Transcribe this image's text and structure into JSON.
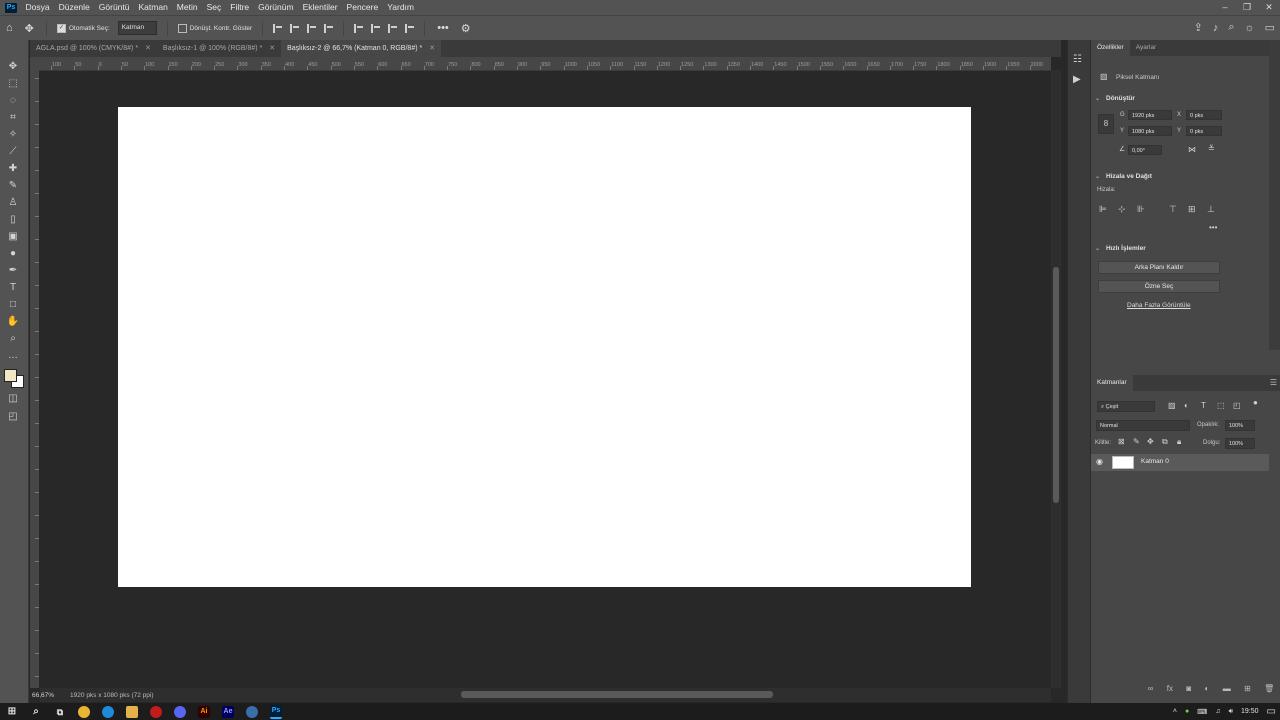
{
  "app": {
    "logo": "Ps"
  },
  "menu": [
    "Dosya",
    "Düzenle",
    "Görüntü",
    "Katman",
    "Metin",
    "Seç",
    "Filtre",
    "Görünüm",
    "Eklentiler",
    "Pencere",
    "Yardım"
  ],
  "window_controls": {
    "minimize": "–",
    "maximize": "❐",
    "close": "✕"
  },
  "options_bar": {
    "auto_select_label": "Otomatik Seç:",
    "auto_select_value": "Katman",
    "transform_label": "Dönüşt. Kontr. Göster",
    "more": "•••"
  },
  "tabs": [
    {
      "label": "AGLA.psd @ 100% (CMYK/8#) *",
      "active": false
    },
    {
      "label": "Başlıksız-1 @ 100% (RGB/8#) *",
      "active": false
    },
    {
      "label": "Başlıksız-2 @ 66,7% (Katman 0, RGB/8#) *",
      "active": true
    }
  ],
  "ruler_ticks": [
    "100",
    "50",
    "0",
    "50",
    "100",
    "150",
    "200",
    "250",
    "300",
    "350",
    "400",
    "450",
    "500",
    "550",
    "600",
    "650",
    "700",
    "750",
    "800",
    "850",
    "900",
    "950",
    "1000",
    "1050",
    "1100",
    "1150",
    "1200",
    "1250",
    "1300",
    "1350",
    "1400",
    "1450",
    "1500",
    "1550",
    "1600",
    "1650",
    "1700",
    "1750",
    "1800",
    "1850",
    "1900",
    "1950",
    "2000",
    "2050"
  ],
  "status": {
    "zoom": "66,67%",
    "doc_info": "1920 pks x 1080 pks (72 ppi)"
  },
  "properties": {
    "tabs": [
      "Özellikler",
      "Ayarlar"
    ],
    "layer_type": "Piksel Katmanı",
    "transform_title": "Dönüştür",
    "w_label": "G",
    "w_value": "1920 pks",
    "h_label": "Y",
    "h_value": "1080 pks",
    "x_label": "X",
    "x_value": "0 pks",
    "y_label": "Y",
    "y_value": "0 pks",
    "angle_value": "0,00°",
    "align_title": "Hizala ve Dağıt",
    "align_label": "Hizala:",
    "quick_title": "Hızlı İşlemler",
    "remove_bg": "Arka Planı Kaldır",
    "select_subject": "Özne Seç",
    "view_more": "Daha Fazla Görüntüle"
  },
  "layers": {
    "title": "Katmanlar",
    "filter": "Çeşit",
    "blend_mode": "Normal",
    "opacity_label": "Opaklık:",
    "opacity_value": "100%",
    "lock_label": "Kilitle:",
    "fill_label": "Dolgu:",
    "fill_value": "100%",
    "layer_name": "Katman 0"
  },
  "taskbar": {
    "time": "19:50"
  },
  "colors": {
    "foreground": "#f1e7c4",
    "background": "#ffffff"
  }
}
